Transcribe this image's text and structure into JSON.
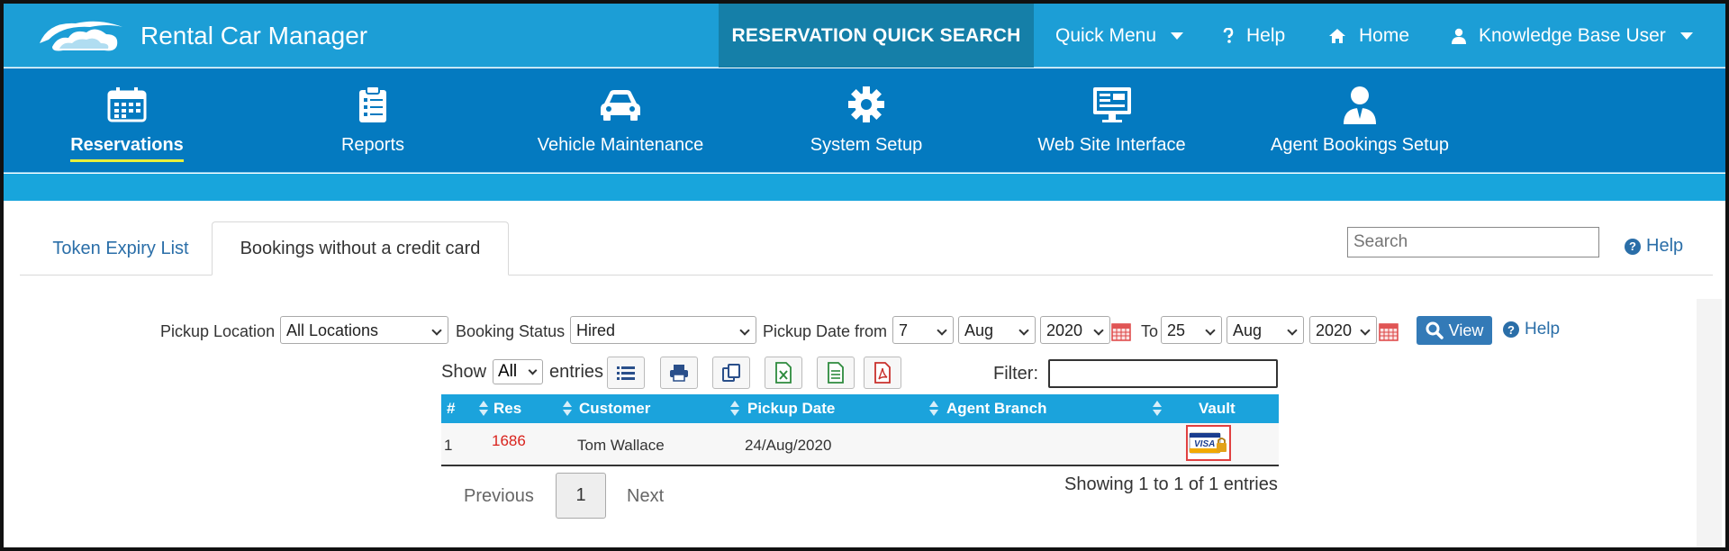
{
  "app": {
    "title": "Rental Car Manager"
  },
  "topbar": {
    "quick_search": "RESERVATION QUICK SEARCH",
    "quick_menu": "Quick Menu",
    "help": "Help",
    "home": "Home",
    "user": "Knowledge Base User"
  },
  "nav": {
    "items": [
      {
        "label": "Reservations",
        "icon": "calendar-icon"
      },
      {
        "label": "Reports",
        "icon": "clipboard-icon"
      },
      {
        "label": "Vehicle Maintenance",
        "icon": "car-icon"
      },
      {
        "label": "System Setup",
        "icon": "gear-icon"
      },
      {
        "label": "Web Site Interface",
        "icon": "monitor-icon"
      },
      {
        "label": "Agent Bookings Setup",
        "icon": "agent-icon"
      }
    ],
    "active": "Reservations"
  },
  "tabs": [
    {
      "label": "Token Expiry List"
    },
    {
      "label": "Bookings without a credit card"
    }
  ],
  "search": {
    "placeholder": "Search"
  },
  "help_label": "Help",
  "filters": {
    "pickup_location_label": "Pickup Location",
    "pickup_location": "All Locations",
    "booking_status_label": "Booking Status",
    "booking_status": "Hired",
    "pickup_from_label": "Pickup Date from",
    "from_day": "7",
    "from_month": "Aug",
    "from_year": "2020",
    "to_label": "To",
    "to_day": "25",
    "to_month": "Aug",
    "to_year": "2020",
    "view_label": "View",
    "help_label": "Help"
  },
  "table_controls": {
    "show_label": "Show",
    "show_value": "All",
    "entries_label": "entries",
    "filter_label": "Filter:"
  },
  "table": {
    "columns": [
      "#",
      "Res",
      "Customer",
      "Pickup Date",
      "Agent Branch",
      "Vault"
    ],
    "rows": [
      {
        "num": "1",
        "res": "1686",
        "customer": "Tom Wallace",
        "pickup_date": "24/Aug/2020",
        "agent_branch": "",
        "vault": "VISA"
      }
    ]
  },
  "pagination": {
    "previous": "Previous",
    "page": "1",
    "next": "Next",
    "summary": "Showing 1 to 1 of 1 entries"
  },
  "colors": {
    "topbar": "#1c9ed6",
    "navbar": "#047ac0",
    "quick_search_bg": "#157fa8",
    "table_header": "#1ba3dc",
    "link": "#2a6ea8",
    "res_link": "#d9231d"
  }
}
